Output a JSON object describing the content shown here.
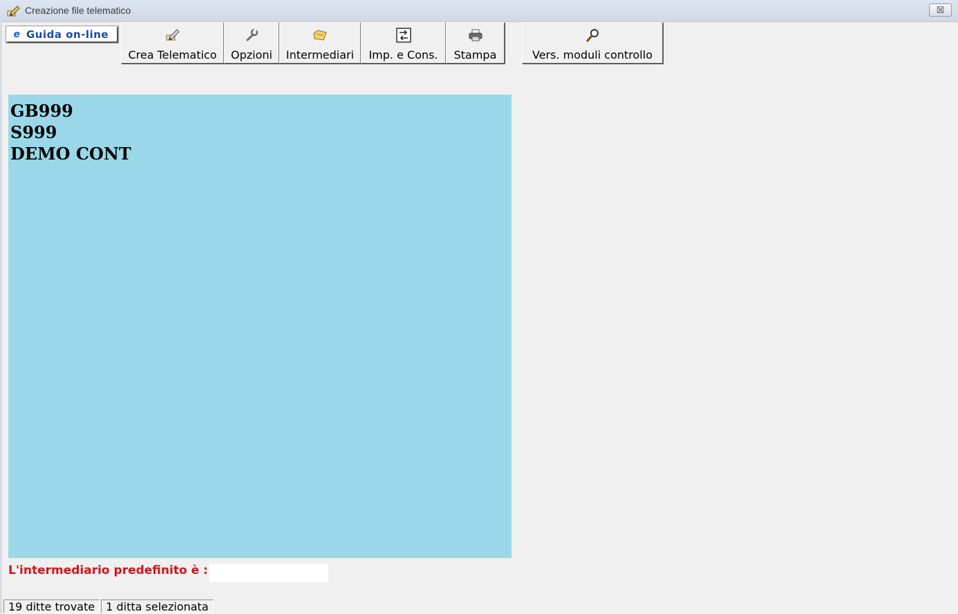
{
  "window": {
    "title": "Creazione file telematico",
    "close_symbol": "☒"
  },
  "toolbar": {
    "help_button": {
      "label": "Guida on-line",
      "icon": "ie-icon"
    },
    "buttons": [
      {
        "label": "Crea Telematico",
        "icon": "edit-pencil-icon"
      },
      {
        "label": "Opzioni",
        "icon": "wrench-icon"
      },
      {
        "label": "Intermediari",
        "icon": "folder-icon"
      },
      {
        "label": "Imp. e Cons.",
        "icon": "import-export-icon"
      },
      {
        "label": "Stampa",
        "icon": "printer-icon"
      }
    ],
    "extra_button": {
      "label": "Vers. moduli controllo",
      "icon": "magnifier-icon"
    }
  },
  "selection_panel": {
    "background": "#9ad8e9",
    "lines": [
      "GB999",
      "S999",
      "DEMO CONT"
    ]
  },
  "default_intermediary": {
    "label": "L'intermediario predefinito è :",
    "value": "",
    "label_color": "#d0161e"
  },
  "status": {
    "found": "19 ditte trovate",
    "selected": "1 ditta selezionata"
  }
}
